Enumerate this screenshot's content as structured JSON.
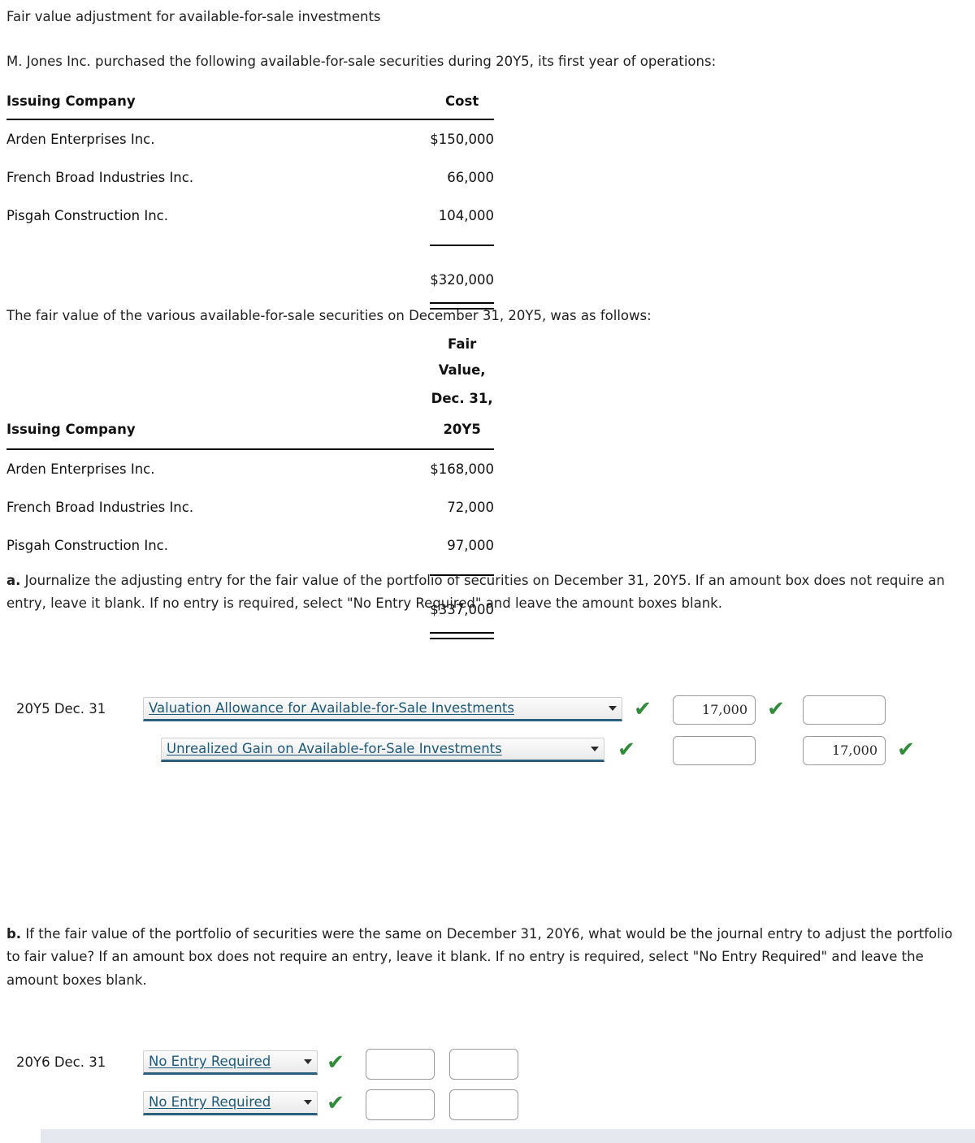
{
  "title": "Fair value adjustment for available-for-sale investments",
  "intro": "M. Jones Inc. purchased the following available-for-sale securities during 20Y5, its first year of operations:",
  "cost_table": {
    "headers": {
      "company": "Issuing Company",
      "amount": "Cost"
    },
    "rows": [
      {
        "company": "Arden Enterprises Inc.",
        "amount": "$150,000"
      },
      {
        "company": "French Broad Industries Inc.",
        "amount": "66,000"
      },
      {
        "company": "Pisgah Construction Inc.",
        "amount": "104,000"
      }
    ],
    "total": "$320,000"
  },
  "fair_value_intro": "The fair value of the various available-for-sale securities on December 31, 20Y5, was as follows:",
  "fair_value_table": {
    "headers": {
      "company": "Issuing Company",
      "amount_line1": "Fair Value,",
      "amount_line2": "Dec. 31, 20Y5"
    },
    "rows": [
      {
        "company": "Arden Enterprises Inc.",
        "amount": "$168,000"
      },
      {
        "company": "French Broad Industries Inc.",
        "amount": "72,000"
      },
      {
        "company": "Pisgah Construction Inc.",
        "amount": "97,000"
      }
    ],
    "total": "$337,000"
  },
  "part_a": {
    "label": "a.",
    "instruction": "Journalize the adjusting entry for the fair value of the portfolio of securities on December 31, 20Y5. If an amount box does not require an entry, leave it blank. If no entry is required, select \"No Entry Required\" and leave the amount boxes blank.",
    "date": "20Y5 Dec. 31",
    "rows": [
      {
        "account": "Valuation Allowance for Available-for-Sale Investments",
        "account_check": "✔",
        "debit": "17,000",
        "debit_check": "✔",
        "credit": "",
        "credit_check": ""
      },
      {
        "account": "Unrealized Gain on Available-for-Sale Investments",
        "account_check": "✔",
        "debit": "",
        "debit_check": "",
        "credit": "17,000",
        "credit_check": "✔"
      }
    ]
  },
  "part_b": {
    "label": "b.",
    "instruction": "If the fair value of the portfolio of securities were the same on December 31, 20Y6, what would be the journal entry to adjust the portfolio to fair value? If an amount box does not require an entry, leave it blank. If no entry is required, select \"No Entry Required\" and leave the amount boxes blank.",
    "date": "20Y6 Dec. 31",
    "rows": [
      {
        "account": "No Entry Required",
        "account_check": "✔",
        "debit": "",
        "credit": ""
      },
      {
        "account": "No Entry Required",
        "account_check": "✔",
        "debit": "",
        "credit": ""
      }
    ]
  },
  "colors": {
    "select_text": "#1d5a7a",
    "check_green": "#2e8b37",
    "rule": "#000000",
    "bottom_bar": "#e5e9ef"
  }
}
